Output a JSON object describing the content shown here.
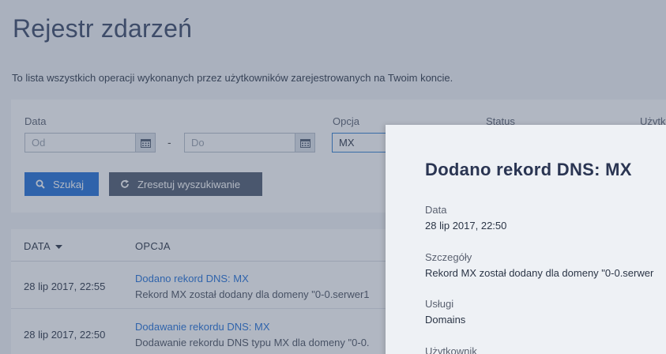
{
  "page": {
    "title": "Rejestr zdarzeń",
    "description": "To lista wszystkich operacji wykonanych przez użytkowników zarejestrowanych na Twoim koncie."
  },
  "filters": {
    "date_label": "Data",
    "from_placeholder": "Od",
    "to_placeholder": "Do",
    "separator": "-",
    "option_label": "Opcja",
    "option_value": "MX",
    "status_label": "Status",
    "user_label": "Użytkownik",
    "search_button": "Szukaj",
    "reset_button": "Zresetuj wyszukiwanie"
  },
  "table": {
    "columns": {
      "date": "DATA",
      "option": "OPCJA"
    },
    "rows": [
      {
        "date": "28 lip 2017, 22:55",
        "title": "Dodano rekord DNS: MX",
        "detail": "Rekord MX został dodany dla domeny \"0-0.serwer1"
      },
      {
        "date": "28 lip 2017, 22:50",
        "title": "Dodawanie rekordu DNS: MX",
        "detail": "Dodawanie rekordu DNS typu MX dla domeny \"0-0."
      }
    ]
  },
  "detail_panel": {
    "title": "Dodano rekord DNS: MX",
    "date_label": "Data",
    "date_value": "28 lip 2017, 22:50",
    "details_label": "Szczegóły",
    "details_value": "Rekord MX został dodany dla domeny \"0-0.serwer",
    "services_label": "Usługi",
    "services_value": "Domains",
    "user_label": "Użytkownik"
  },
  "colors": {
    "accent": "#1f6fd8",
    "overlay": "#46546e"
  },
  "icons": {
    "calendar": "calendar-icon",
    "search": "search-icon",
    "reset": "refresh-icon",
    "sort": "caret-down-icon"
  }
}
